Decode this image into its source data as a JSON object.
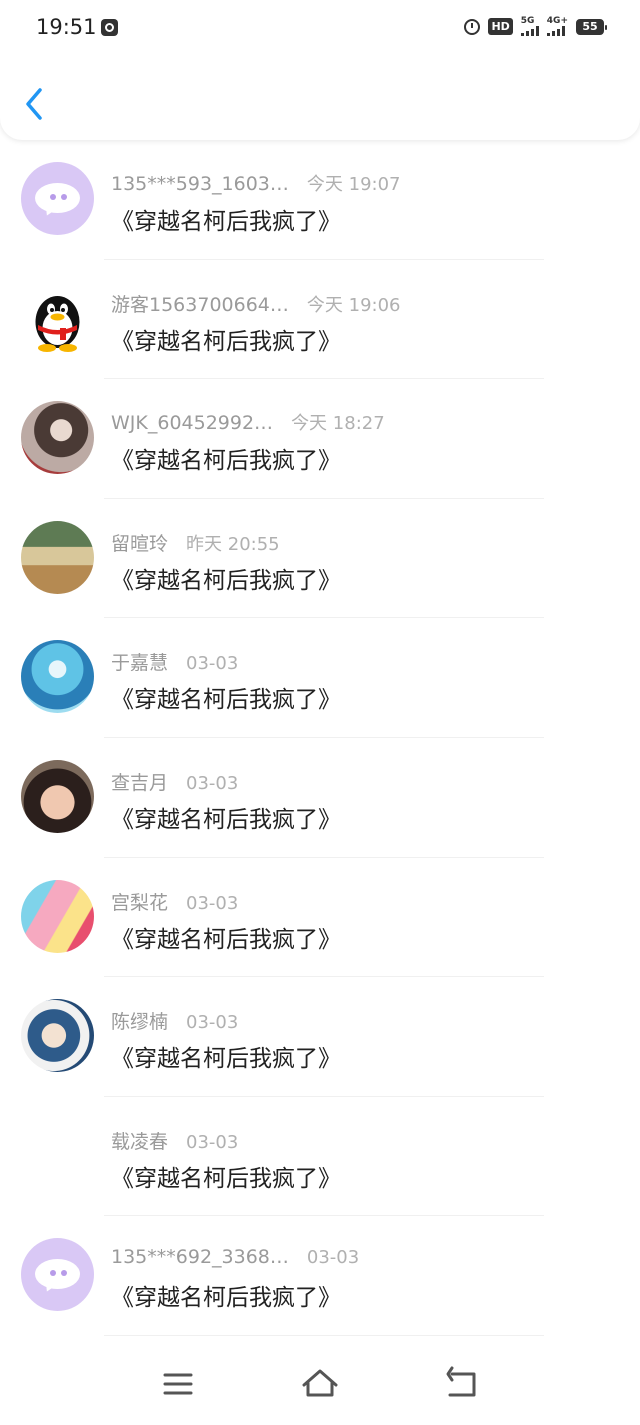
{
  "status_bar": {
    "time": "19:51",
    "hd_label": "HD",
    "net1_label": "5G",
    "net2_label": "4G+",
    "battery_level": "55"
  },
  "messages": [
    {
      "name": "135***593_1603…",
      "time": "今天 19:07",
      "text": "《穿越名柯后我疯了》",
      "avatar": "chat-bubble-icon"
    },
    {
      "name": "游客1563700664…",
      "time": "今天 19:06",
      "text": "《穿越名柯后我疯了》",
      "avatar": "qq-penguin-icon"
    },
    {
      "name": "WJK_60452992…",
      "time": "今天 18:27",
      "text": "《穿越名柯后我疯了》",
      "avatar": "photo-avatar"
    },
    {
      "name": "留暄玲",
      "time": "昨天 20:55",
      "text": "《穿越名柯后我疯了》",
      "avatar": "photo-avatar"
    },
    {
      "name": "于嘉慧",
      "time": "03-03",
      "text": "《穿越名柯后我疯了》",
      "avatar": "photo-avatar"
    },
    {
      "name": "查吉月",
      "time": "03-03",
      "text": "《穿越名柯后我疯了》",
      "avatar": "photo-avatar"
    },
    {
      "name": "宫梨花",
      "time": "03-03",
      "text": "《穿越名柯后我疯了》",
      "avatar": "photo-avatar"
    },
    {
      "name": "陈缪楠",
      "time": "03-03",
      "text": "《穿越名柯后我疯了》",
      "avatar": "photo-avatar"
    },
    {
      "name": "载凌春",
      "time": "03-03",
      "text": "《穿越名柯后我疯了》",
      "avatar": "none"
    },
    {
      "name": "135***692_3368…",
      "time": "03-03",
      "text": "《穿越名柯后我疯了》",
      "avatar": "chat-bubble-icon"
    }
  ],
  "colors": {
    "accent": "#2196f3",
    "chat_avatar_bg": "#d9c8f5",
    "name_text": "#9a9a9a",
    "message_text": "#222222"
  },
  "icons": {
    "back": "back-chevron-icon",
    "menu": "menu-icon",
    "home": "home-icon",
    "return": "return-icon"
  }
}
